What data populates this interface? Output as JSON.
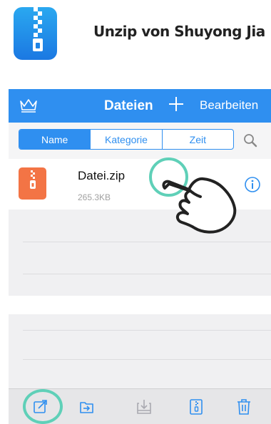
{
  "header": {
    "title": "Unzip von Shuyong Jia",
    "icon": "zip-app-icon"
  },
  "navbar": {
    "title": "Dateien",
    "edit_label": "Bearbeiten",
    "crown_icon": "crown-icon",
    "add_icon": "plus-icon",
    "color": "#2f8ff0"
  },
  "segments": [
    {
      "label": "Name",
      "active": true
    },
    {
      "label": "Kategorie",
      "active": false
    },
    {
      "label": "Zeit",
      "active": false
    }
  ],
  "files": [
    {
      "name": "Datei.zip",
      "size": "265.3KB",
      "icon": "zip-file-icon"
    }
  ],
  "toolbar": {
    "buttons": [
      "share-icon",
      "move-to-folder-icon",
      "import-icon",
      "compress-icon",
      "trash-icon"
    ]
  },
  "colors": {
    "accent": "#2f8ff0",
    "file_thumb": "#f37445",
    "highlight": "#5fd0b8"
  }
}
